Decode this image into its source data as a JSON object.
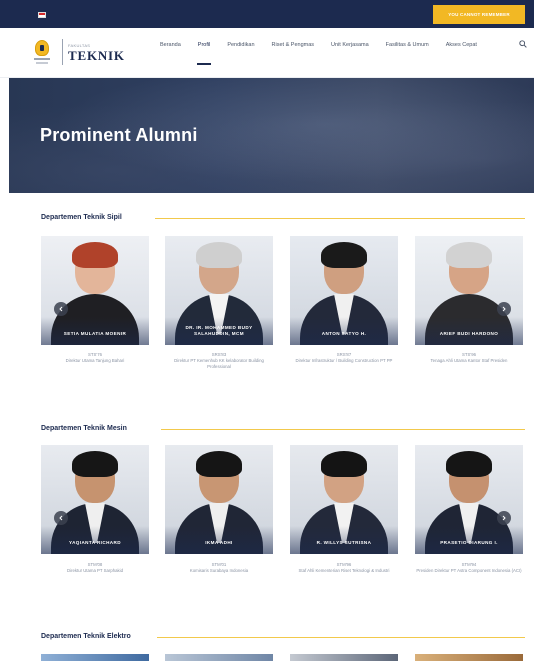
{
  "topbar": {
    "cta_label": "YOU CANNOT REMEMBER",
    "flag_icon": "indonesia-flag-icon"
  },
  "header": {
    "logo_small": "FAKULTAS",
    "logo_big": "TEKNIK",
    "nav": [
      "Beranda",
      "Profil",
      "Pendidikan",
      "Riset & Pengmas",
      "Unit Kerjasama",
      "Fasilitas & Umum",
      "Akses Cepat"
    ],
    "active_nav": "Profil",
    "search_icon": "search-icon"
  },
  "hero": {
    "title": "Prominent Alumni"
  },
  "sections": [
    {
      "title": "Departemen Teknik Sipil",
      "cards": [
        {
          "name": "SETIA MULATIA MOENIR",
          "year": "STS'76",
          "role": "Direktur Utama Tanjung Bahari"
        },
        {
          "name": "DR. IR. MOHAMMED BUDY SALAHUDDIN, MCM",
          "year": "SRS'83",
          "role": "Direktur PT Kemenhub KK kelaborator Building Professional"
        },
        {
          "name": "ANTON SATYO H.",
          "year": "SRS'87",
          "role": "Direktur Infrastruktur / Building Construction PT PP"
        },
        {
          "name": "ARIEF BUDI HARDONO",
          "year": "STS'96",
          "role": "Tenaga Ahli Utama Kantor Staf Presiden"
        }
      ]
    },
    {
      "title": "Departemen Teknik Mesin",
      "cards": [
        {
          "name": "YAQIANTA RICHARD",
          "year": "STM'08",
          "role": "Direktur Utama PT Sarphakid"
        },
        {
          "name": "IKMA ADHI",
          "year": "STM'01",
          "role": "Komisaris Surabaya Indonesia"
        },
        {
          "name": "R. WILLYS SUTRISNA",
          "year": "STM'96",
          "role": "Staf Ahli Kementerian Riset Teknologi & Industri"
        },
        {
          "name": "PRASETIO DIARUNG I.",
          "year": "STM'94",
          "role": "Presiden Direktur PT Astra Component Indonesia (ACI)"
        }
      ]
    },
    {
      "title": "Departemen Teknik Elektro"
    }
  ],
  "colors": {
    "navy": "#1c2a4f",
    "gold": "#f2b824",
    "caption": "#8a93a3"
  }
}
